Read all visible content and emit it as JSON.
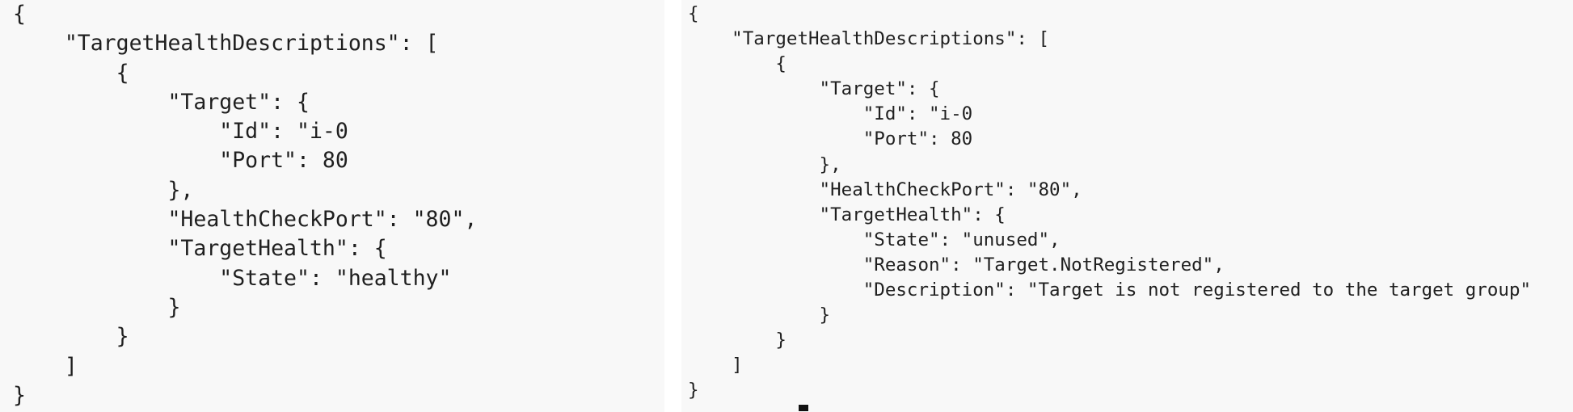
{
  "left_panel": {
    "lines": [
      "{",
      "    \"TargetHealthDescriptions\": [",
      "        {",
      "            \"Target\": {",
      "                \"Id\": \"i-0",
      "                \"Port\": 80",
      "            },",
      "            \"HealthCheckPort\": \"80\",",
      "            \"TargetHealth\": {",
      "                \"State\": \"healthy\"",
      "            }",
      "        }",
      "    ]",
      "}"
    ]
  },
  "right_panel": {
    "lines": [
      "{",
      "    \"TargetHealthDescriptions\": [",
      "        {",
      "            \"Target\": {",
      "                \"Id\": \"i-0",
      "                \"Port\": 80",
      "            },",
      "            \"HealthCheckPort\": \"80\",",
      "            \"TargetHealth\": {",
      "                \"State\": \"unused\",",
      "                \"Reason\": \"Target.NotRegistered\",",
      "                \"Description\": \"Target is not registered to the target group\"",
      "            }",
      "        }",
      "    ]",
      "}"
    ]
  }
}
